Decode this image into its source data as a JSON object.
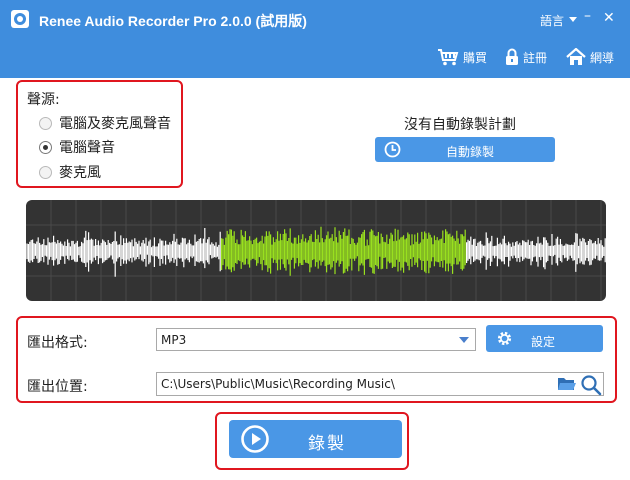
{
  "window": {
    "title": "Renee Audio Recorder Pro 2.0.0 (試用版)",
    "language": "語言",
    "min_glyph": "–",
    "close_glyph": "✕"
  },
  "toolbar": {
    "buy": "購買",
    "register": "註冊",
    "home": "網導"
  },
  "audio_source": {
    "label": "聲源:",
    "options": [
      {
        "label": "電腦及麥克風聲音",
        "selected": false
      },
      {
        "label": "電腦聲音",
        "selected": true
      },
      {
        "label": "麥克風",
        "selected": false
      }
    ]
  },
  "schedule": {
    "status": "沒有自動錄製計劃",
    "button": "自動錄製"
  },
  "waveform": {
    "background": "#333333",
    "idle_color": "#ffffff",
    "active_color": "#99e01f"
  },
  "export": {
    "format_label": "匯出格式:",
    "format_value": "MP3",
    "settings_button": "設定",
    "location_label": "匯出位置:",
    "location_value": "C:\\Users\\Public\\Music\\Recording Music\\"
  },
  "record": {
    "button": "錄製"
  },
  "colors": {
    "accent": "#3f8ddd",
    "button": "#4a97e6",
    "highlight": "#e0161f"
  },
  "icons": {
    "app": "app-logo-icon",
    "cart": "cart-icon",
    "lock": "lock-icon",
    "home": "home-icon",
    "clock": "clock-icon",
    "gear": "gear-icon",
    "folder": "folder-icon",
    "search": "search-icon",
    "play": "play-icon"
  }
}
